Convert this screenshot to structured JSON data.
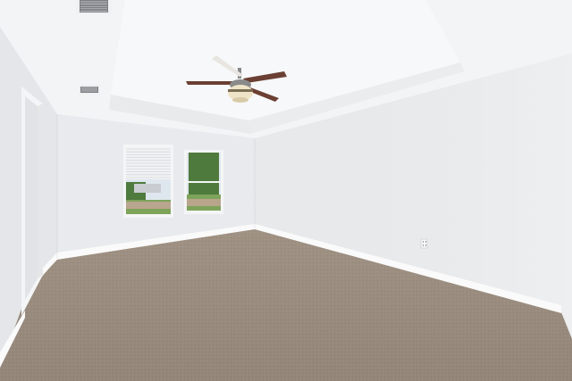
{
  "scene": {
    "colors": {
      "ceiling": "#f3f4f6",
      "ceiling_tray": "#f7f8f9",
      "left_wall": "#e4e6e9",
      "back_wall": "#e8eaed",
      "right_wall": "#eceef0",
      "baseboard": "#fafafa",
      "carpet": "#a8998a",
      "carpet_dark": "#9a8b7c",
      "door_frame": "#f4f5f6",
      "fan_blade": "#6b3f33",
      "fan_blade_light": "#e9e6e2",
      "fan_body": "#8a8a8a",
      "light_globe": "#efe4c8",
      "window_sky": "#dfe7ee",
      "window_tree": "#4f7a3d",
      "window_grass": "#7ea35b",
      "vent": "#7c7f84"
    },
    "icons": [
      "ceiling-fan-icon",
      "air-vent-icon",
      "electrical-outlet-icon"
    ]
  }
}
